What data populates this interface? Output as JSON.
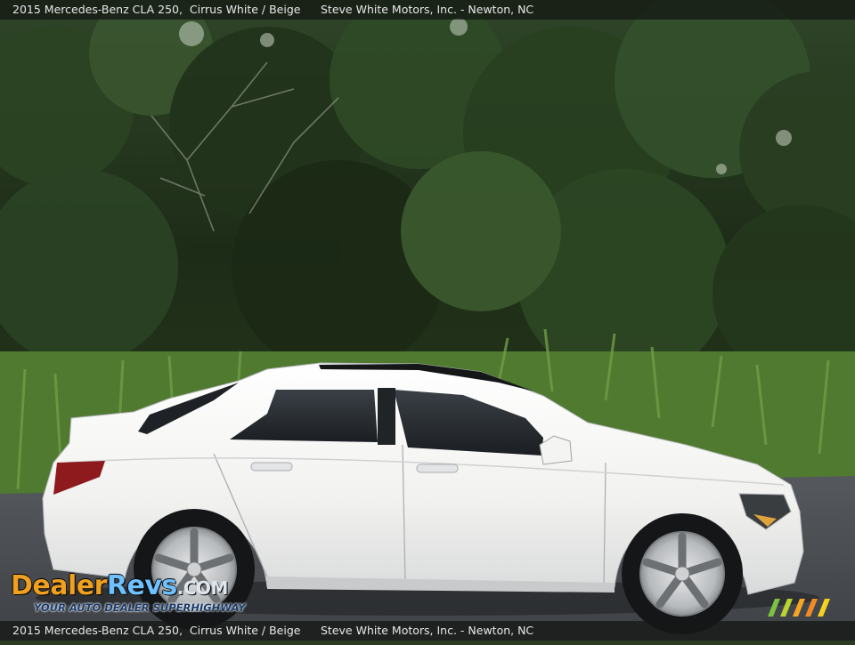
{
  "caption": {
    "vehicle": "2015 Mercedes-Benz CLA 250,",
    "color": "Cirrus White / Beige",
    "dealer": "Steve White Motors, Inc. - Newton, NC"
  },
  "watermark": {
    "brand_dealer": "Dealer",
    "brand_revs": "Revs",
    "brand_tld": ".COM",
    "tagline": "YOUR AUTO DEALER SUPERHIGHWAY"
  },
  "colors": {
    "caption_bg": "#141814",
    "car_body": "#f2f2f0",
    "foliage_dark": "#1f2e18",
    "grass": "#5d8a3a",
    "road": "#4a4d52",
    "logo_orange": "#f0a020",
    "logo_blue": "#6ec0ff"
  }
}
